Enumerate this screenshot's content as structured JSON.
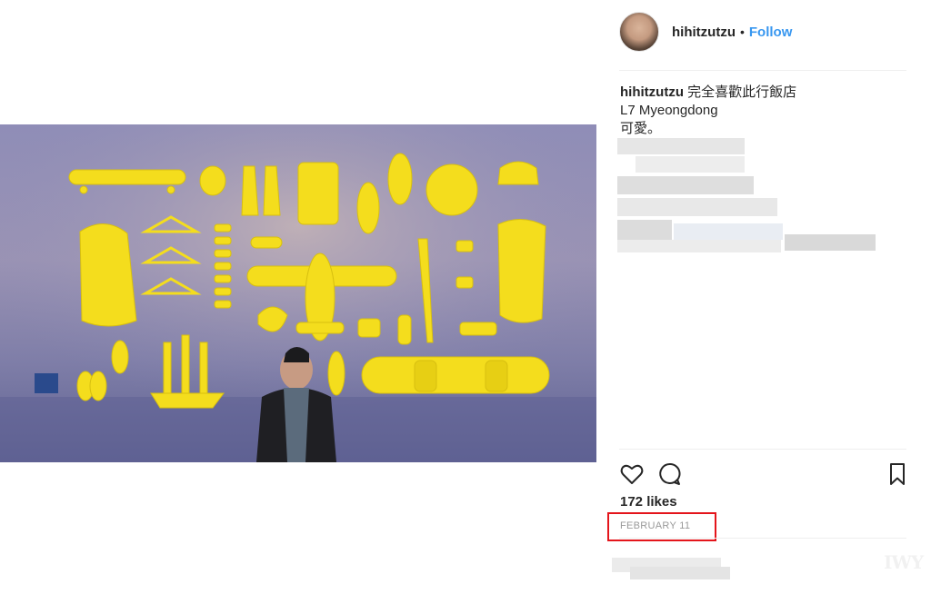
{
  "post": {
    "username": "hihitzutzu",
    "separator": "•",
    "follow_label": "Follow",
    "caption": {
      "username": "hihitzutzu",
      "line1": "完全喜歡此行飯店",
      "line2": "L7 Myeongdong",
      "line3": "可愛。"
    },
    "likes": "172 likes",
    "date": "February 11",
    "watermark": "IWY"
  },
  "icons": {
    "like": "heart-icon",
    "comment": "speech-bubble-icon",
    "save": "bookmark-icon"
  },
  "colors": {
    "link": "#3897f0",
    "highlight_box": "#e4151b",
    "object_yellow": "#f4dd1d",
    "wall": "#8f8db7"
  }
}
